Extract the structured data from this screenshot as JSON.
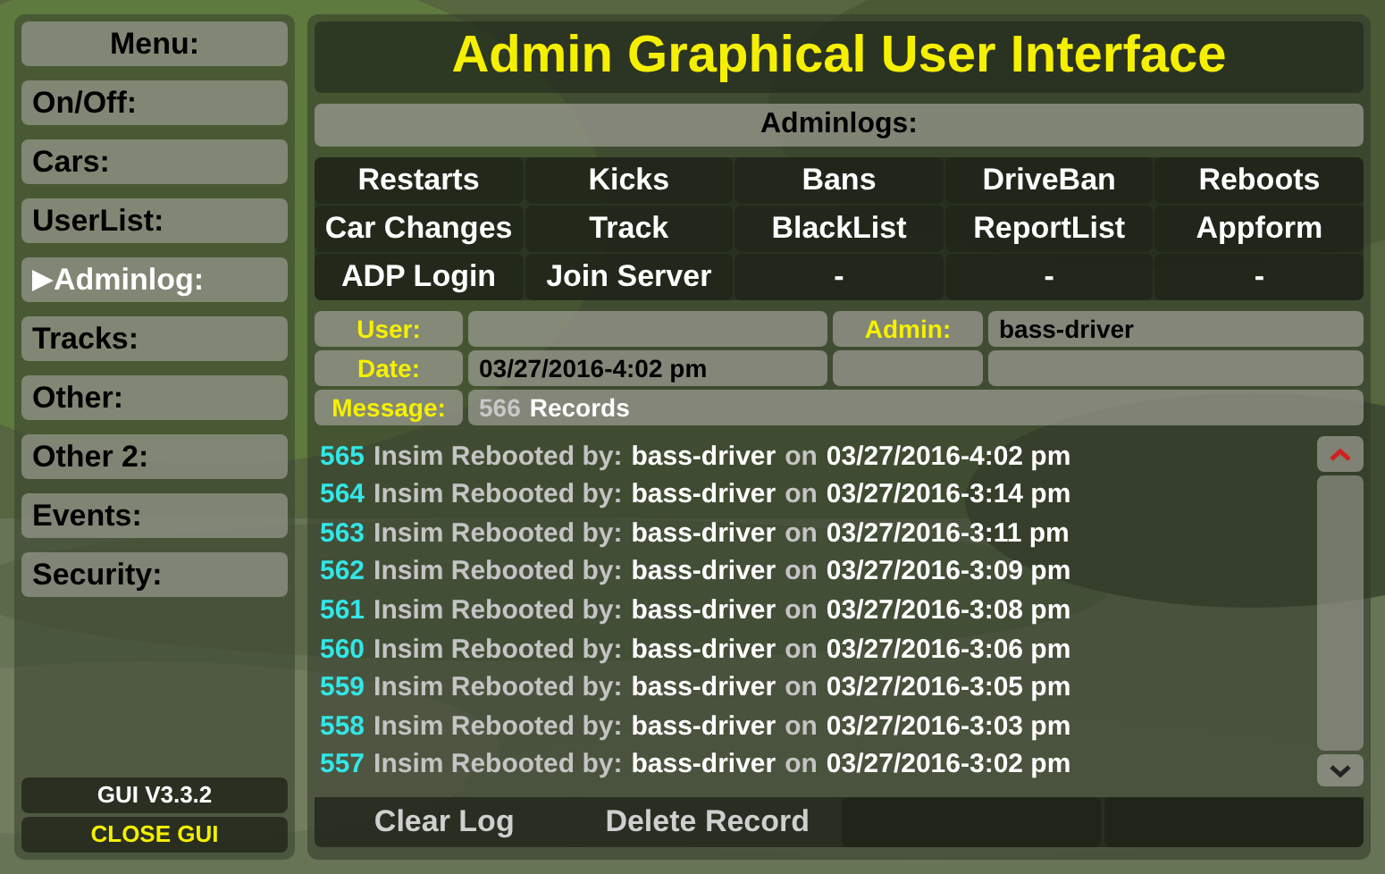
{
  "menu": {
    "title": "Menu:",
    "items": [
      {
        "label": "On/Off:",
        "selected": false
      },
      {
        "label": "Cars:",
        "selected": false
      },
      {
        "label": "UserList:",
        "selected": false
      },
      {
        "label": "Adminlog:",
        "selected": true
      },
      {
        "label": "Tracks:",
        "selected": false
      },
      {
        "label": "Other:",
        "selected": false
      },
      {
        "label": "Other 2:",
        "selected": false
      },
      {
        "label": "Events:",
        "selected": false
      },
      {
        "label": "Security:",
        "selected": false
      }
    ],
    "version": "GUI V3.3.2",
    "close_button": "CLOSE GUI"
  },
  "window": {
    "title": "Admin Graphical User Interface"
  },
  "section_title": "Adminlogs:",
  "log_buttons": [
    "Restarts",
    "Kicks",
    "Bans",
    "DriveBan",
    "Reboots",
    "Car Changes",
    "Track",
    "BlackList",
    "ReportList",
    "Appform",
    "ADP Login",
    "Join Server",
    "-",
    "-",
    "-"
  ],
  "details": {
    "user_label": "User:",
    "admin_label": "Admin:",
    "admin_value": "bass-driver",
    "date_label": "Date:",
    "date_value": "03/27/2016-4:02 pm",
    "message_label": "Message:",
    "record_count": "566",
    "records_label": "Records"
  },
  "log_entries": [
    {
      "id": "565",
      "action": "Insim Rebooted by:",
      "user": "bass-driver",
      "preposition": "on",
      "date": "03/27/2016-4:02 pm"
    },
    {
      "id": "564",
      "action": "Insim Rebooted by:",
      "user": "bass-driver",
      "preposition": "on",
      "date": "03/27/2016-3:14 pm"
    },
    {
      "id": "563",
      "action": "Insim Rebooted by:",
      "user": "bass-driver",
      "preposition": "on",
      "date": "03/27/2016-3:11 pm"
    },
    {
      "id": "562",
      "action": "Insim Rebooted by:",
      "user": "bass-driver",
      "preposition": "on",
      "date": "03/27/2016-3:09 pm"
    },
    {
      "id": "561",
      "action": "Insim Rebooted by:",
      "user": "bass-driver",
      "preposition": "on",
      "date": "03/27/2016-3:08 pm"
    },
    {
      "id": "560",
      "action": "Insim Rebooted by:",
      "user": "bass-driver",
      "preposition": "on",
      "date": "03/27/2016-3:06 pm"
    },
    {
      "id": "559",
      "action": "Insim Rebooted by:",
      "user": "bass-driver",
      "preposition": "on",
      "date": "03/27/2016-3:05 pm"
    },
    {
      "id": "558",
      "action": "Insim Rebooted by:",
      "user": "bass-driver",
      "preposition": "on",
      "date": "03/27/2016-3:03 pm"
    },
    {
      "id": "557",
      "action": "Insim Rebooted by:",
      "user": "bass-driver",
      "preposition": "on",
      "date": "03/27/2016-3:02 pm"
    }
  ],
  "footer_buttons": [
    "Clear Log",
    "Delete Record"
  ]
}
